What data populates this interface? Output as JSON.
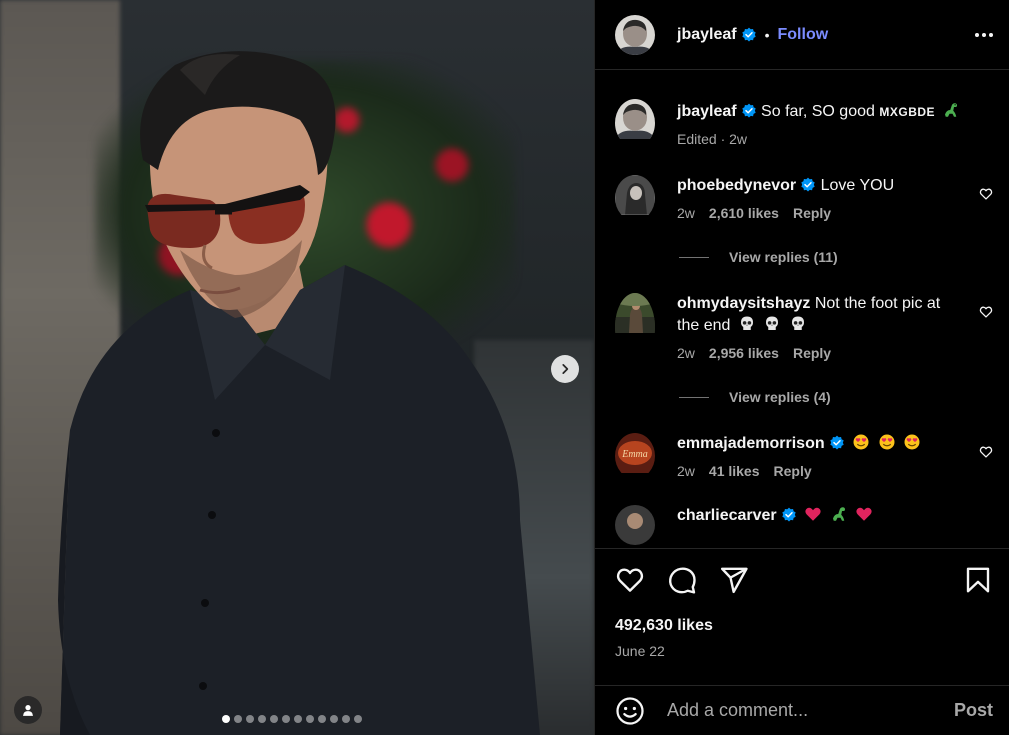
{
  "post": {
    "author": "jbayleaf",
    "follow_label": "Follow",
    "separator": "•",
    "caption": {
      "text": "So far, SO good",
      "tag": "MXGBDE",
      "edited_label": "Edited · 2w"
    },
    "slide_count": 12,
    "active_slide": 0
  },
  "comments": [
    {
      "user": "phoebedynevor",
      "verified": true,
      "text": "Love YOU",
      "age": "2w",
      "likes": "2,610 likes",
      "reply_label": "Reply",
      "view_replies": "View replies (11)"
    },
    {
      "user": "ohmydaysitshayz",
      "verified": false,
      "text": "Not the foot pic at the end",
      "age": "2w",
      "likes": "2,956 likes",
      "reply_label": "Reply",
      "view_replies": "View replies (4)"
    },
    {
      "user": "emmajademorrison",
      "verified": true,
      "text": "",
      "age": "2w",
      "likes": "41 likes",
      "reply_label": "Reply"
    },
    {
      "user": "charliecarver",
      "verified": true,
      "text": ""
    }
  ],
  "footer": {
    "likes": "492,630 likes",
    "date": "June 22",
    "comment_placeholder": "Add a comment...",
    "post_label": "Post"
  },
  "icons": {
    "like": "heart-icon",
    "comment": "comment-icon",
    "share": "share-icon",
    "save": "bookmark-icon",
    "emoji": "emoji-icon",
    "next": "chevron-right-icon",
    "tag": "user-tag-icon"
  },
  "colors": {
    "accent": "#0095f6",
    "follow": "#7b8cff",
    "muted": "#a8a8a8"
  }
}
